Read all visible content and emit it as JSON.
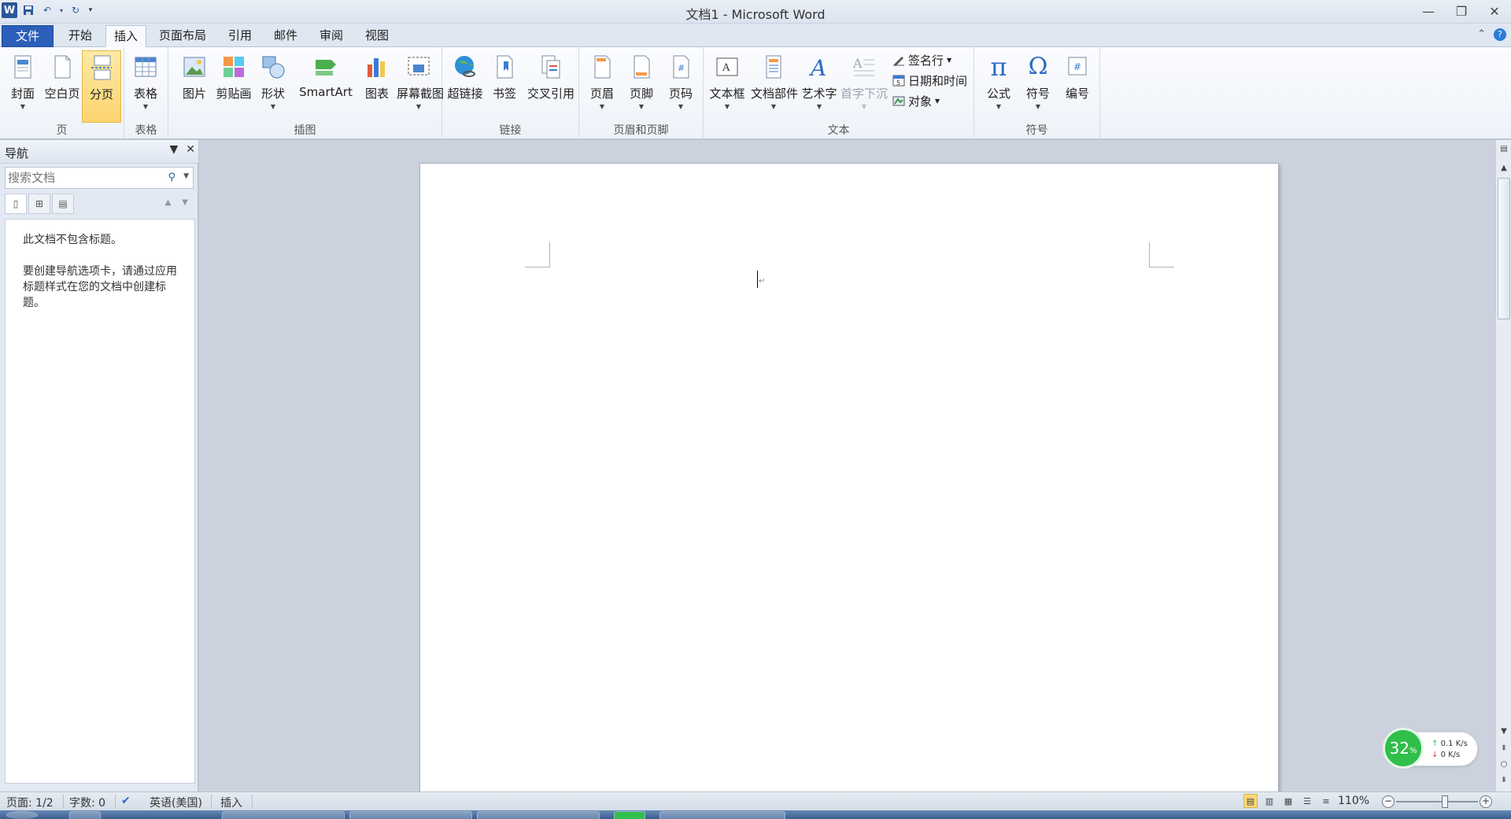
{
  "window": {
    "title": "文档1 - Microsoft Word",
    "app_icon": "W",
    "controls": [
      "minimize-icon",
      "restore-icon",
      "close-icon"
    ]
  },
  "tabs": {
    "file": "文件",
    "items": [
      "开始",
      "插入",
      "页面布局",
      "引用",
      "邮件",
      "审阅",
      "视图"
    ],
    "active": "插入"
  },
  "ribbon": {
    "groups": {
      "pages": "页",
      "tables": "表格",
      "illustrations": "插图",
      "links": "链接",
      "header_footer": "页眉和页脚",
      "text": "文本",
      "symbols": "符号"
    },
    "buttons": {
      "cover": "封面",
      "blank_page": "空白页",
      "page_break": "分页",
      "table": "表格",
      "picture": "图片",
      "clipart": "剪贴画",
      "shapes": "形状",
      "smartart": "SmartArt",
      "chart": "图表",
      "screenshot": "屏幕截图",
      "hyperlink": "超链接",
      "bookmark": "书签",
      "cross_ref": "交叉引用",
      "header": "页眉",
      "footer": "页脚",
      "page_number": "页码",
      "textbox": "文本框",
      "quickparts": "文档部件",
      "wordart": "艺术字",
      "dropcap": "首字下沉",
      "signature": "签名行",
      "datetime": "日期和时间",
      "object": "对象",
      "equation": "公式",
      "symbol": "符号",
      "number": "编号"
    },
    "equation_glyph": "π",
    "symbol_glyph": "Ω"
  },
  "nav": {
    "title": "导航",
    "search_placeholder": "搜索文档",
    "message1": "此文档不包含标题。",
    "message2": "要创建导航选项卡，请通过应用标题样式在您的文档中创建标题。"
  },
  "network": {
    "percent": "32",
    "unit": "%",
    "up": "0.1 K/s",
    "down": "0 K/s"
  },
  "status": {
    "page": "页面: 1/2",
    "words": "字数: 0",
    "language": "英语(美国)",
    "mode": "插入",
    "zoom": "110%"
  },
  "colors": {
    "file_tab": "#2b5fb9",
    "highlight": "#fcd46e",
    "word_blue": "#2b579a"
  }
}
